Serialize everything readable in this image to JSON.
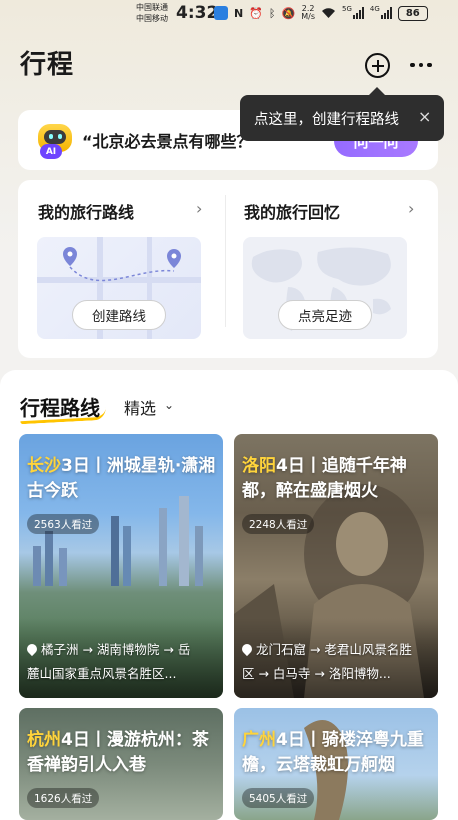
{
  "status_bar": {
    "carrier1": "中国联通",
    "carrier2": "中国移动",
    "time": "4:32",
    "net_speed_value": "2.2",
    "net_speed_unit": "M/s",
    "signal1_label": "5G",
    "signal2_label": "4G",
    "battery": "86"
  },
  "header": {
    "title": "行程"
  },
  "tooltip": {
    "text": "点这里，创建行程路线",
    "close": "×"
  },
  "ai_banner": {
    "badge": "AI",
    "question": "“北京必去景点有哪些？”",
    "ask_button": "问一问"
  },
  "travel": {
    "routes_title": "我的旅行路线",
    "memories_title": "我的旅行回忆",
    "chevron": "›",
    "create_route_button": "创建路线",
    "light_footprints_button": "点亮足迹"
  },
  "section": {
    "title": "行程路线",
    "filter": "精选",
    "filter_chevron": "⌄"
  },
  "routes": [
    {
      "city": "长沙",
      "title_rest": "3日丨洲城星轨·潇湘古今跃",
      "views": "2563人看过",
      "route_line1": "橘子洲 → 湖南博物院 → 岳",
      "route_line2": "麓山国家重点风景名胜区..."
    },
    {
      "city": "洛阳",
      "title_rest": "4日丨追随千年神都，醉在盛唐烟火",
      "views": "2248人看过",
      "route_line1": "龙门石窟 → 老君山风景名胜",
      "route_line2": "区 → 白马寺 → 洛阳博物..."
    },
    {
      "city": "杭州",
      "title_rest": "4日丨漫游杭州：茶香禅韵引人入巷",
      "views": "1626人看过"
    },
    {
      "city": "广州",
      "title_rest": "4日丨骑楼淬粤九重檐，云塔裁虹万舸烟",
      "views": "5405人看过"
    }
  ],
  "colors": {
    "accent_purple": "#8a5cff",
    "city_highlight": "#ffd43b",
    "underline_yellow": "#ffc400",
    "tooltip_bg": "#2e2e2e"
  },
  "icons": [
    "add-icon",
    "more-icon",
    "robot-icon",
    "close-icon",
    "chevron-right-icon",
    "location-pin-icon",
    "chevron-down-icon"
  ]
}
